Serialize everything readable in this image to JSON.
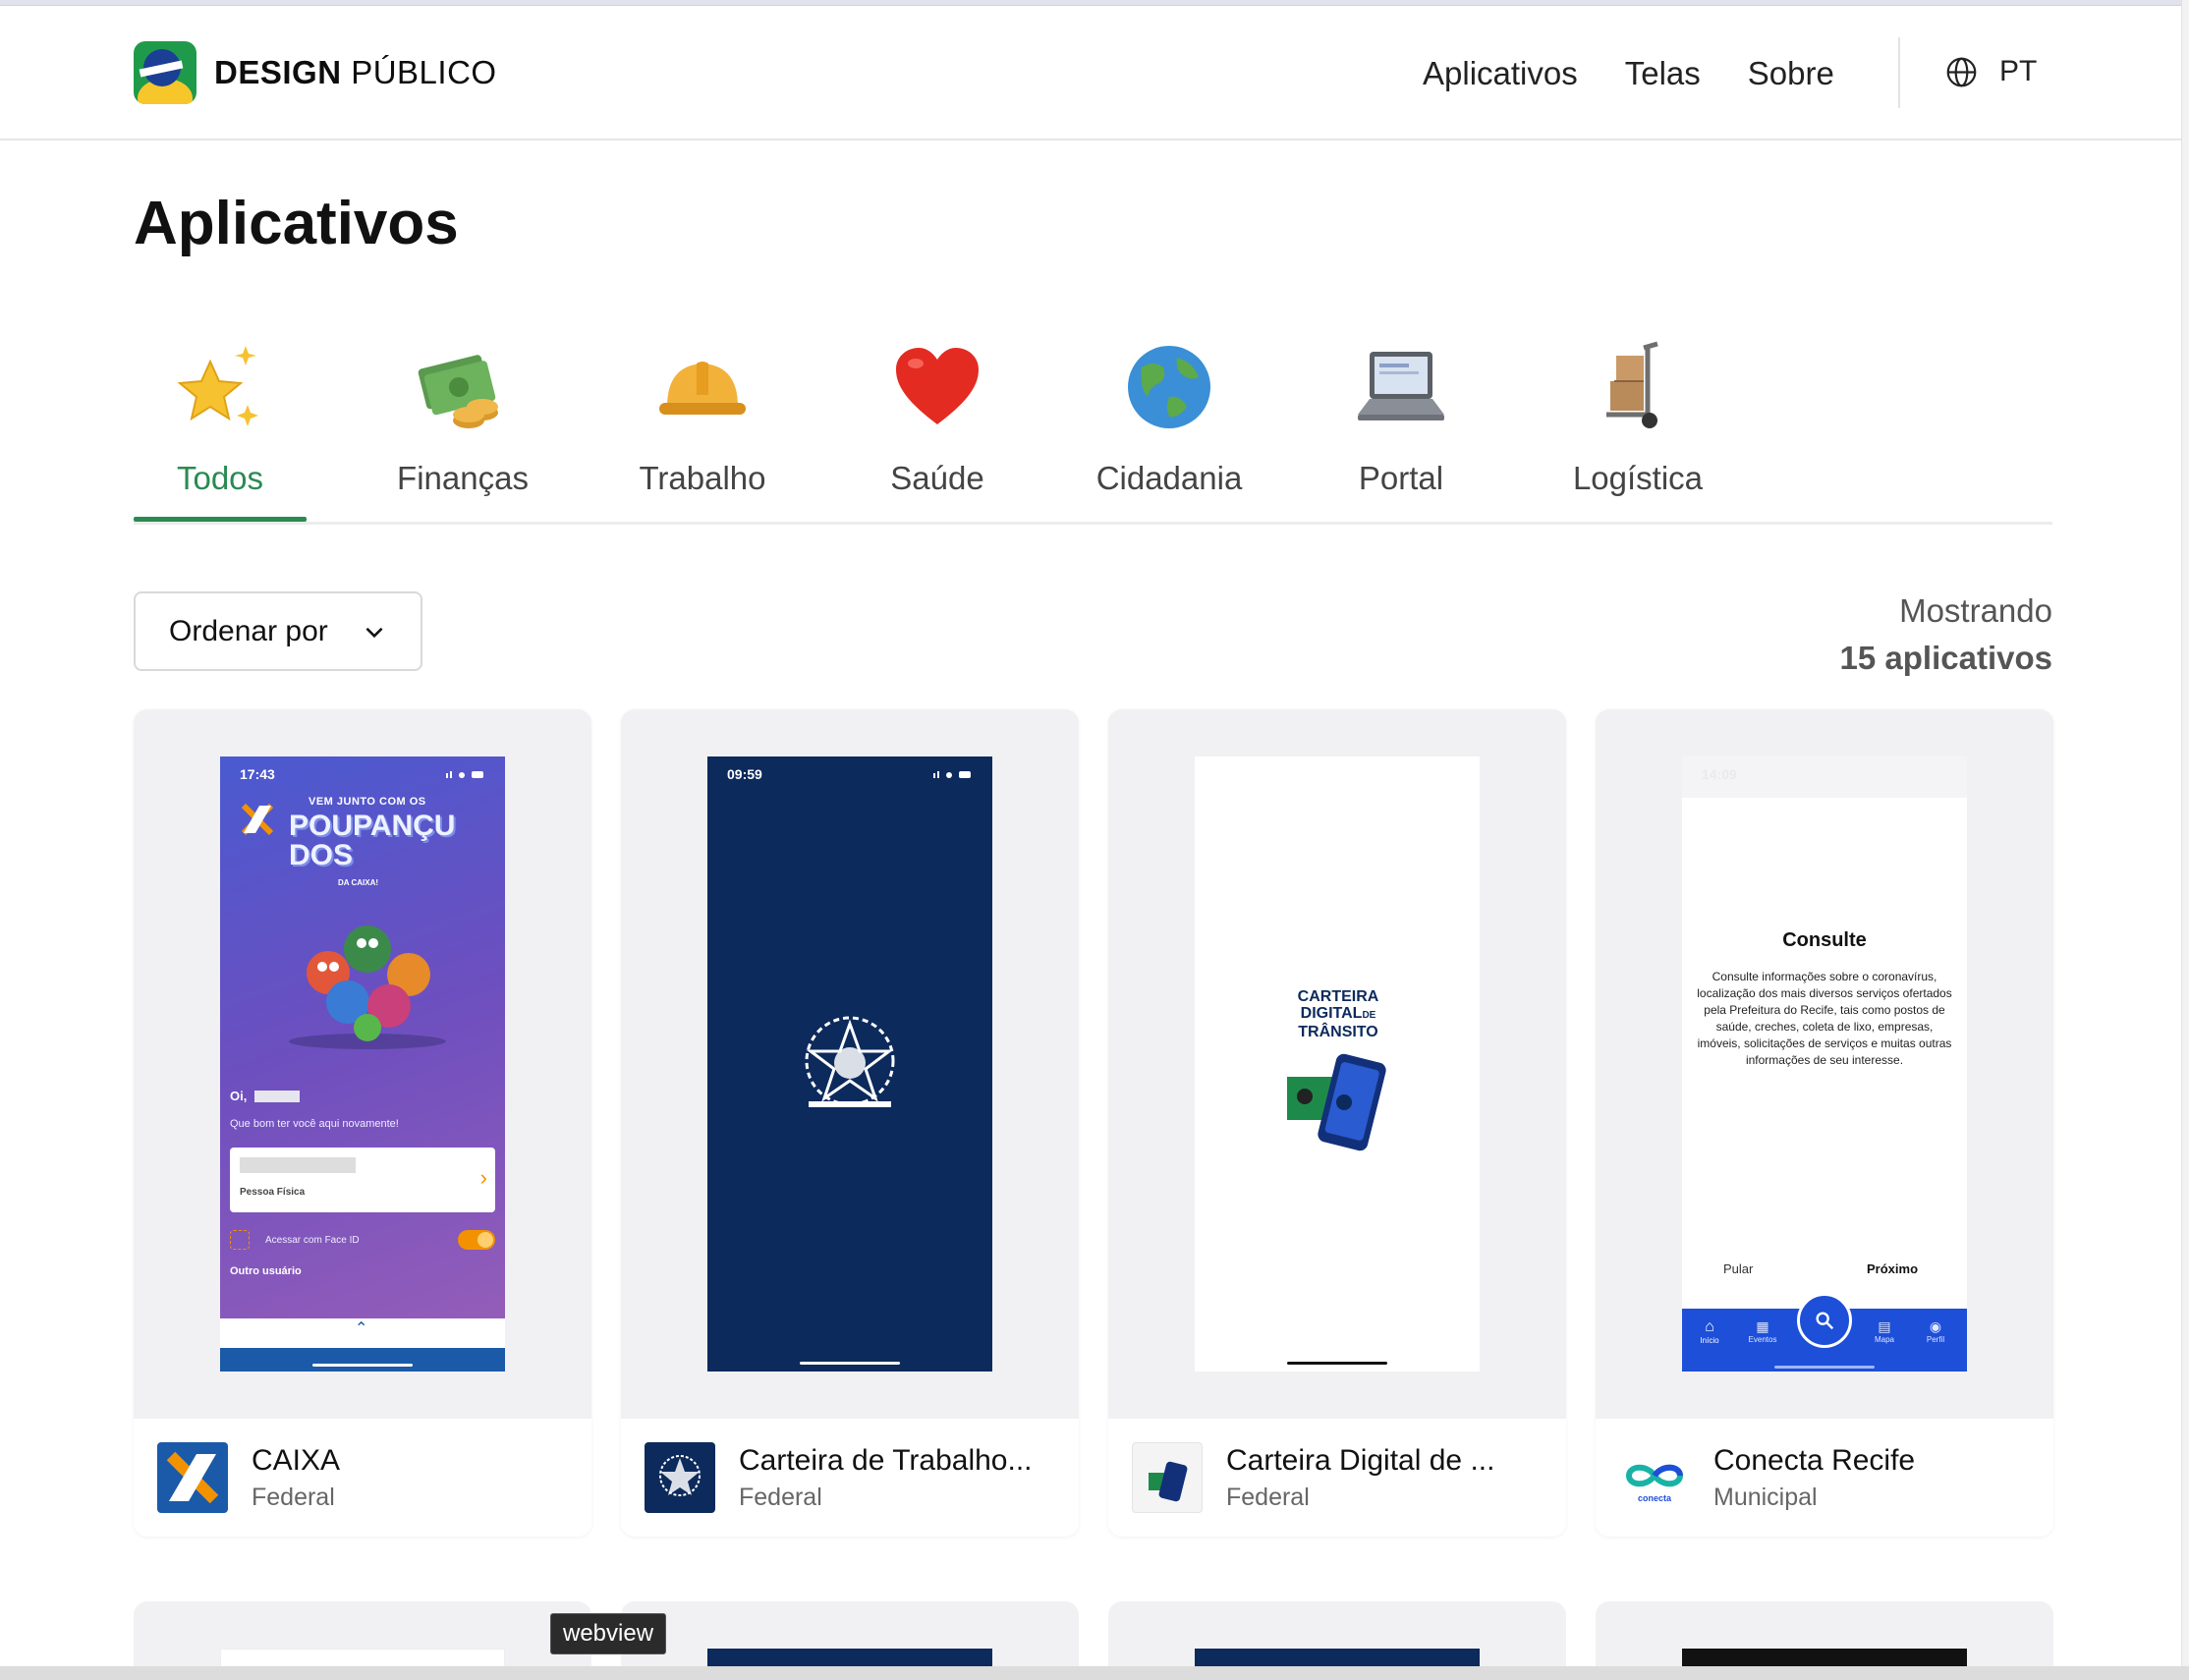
{
  "header": {
    "brand_bold": "DESIGN",
    "brand_regular": "PÚBLICO",
    "nav": [
      "Aplicativos",
      "Telas",
      "Sobre"
    ],
    "language": "PT"
  },
  "page": {
    "title": "Aplicativos"
  },
  "categories": [
    {
      "label": "Todos",
      "icon": "star-icon",
      "active": true
    },
    {
      "label": "Finanças",
      "icon": "money-icon"
    },
    {
      "label": "Trabalho",
      "icon": "hardhat-icon"
    },
    {
      "label": "Saúde",
      "icon": "heart-icon"
    },
    {
      "label": "Cidadania",
      "icon": "globe-icon"
    },
    {
      "label": "Portal",
      "icon": "laptop-icon"
    },
    {
      "label": "Logística",
      "icon": "handtruck-icon"
    }
  ],
  "sort": {
    "label": "Ordenar por"
  },
  "count": {
    "line1": "Mostrando",
    "line2": "15 aplicativos"
  },
  "apps": [
    {
      "name": "CAIXA",
      "level": "Federal",
      "screen": {
        "time": "17:43",
        "headline_top": "VEM JUNTO COM OS",
        "headline_main": "POUPANÇUDOS",
        "headline_bottom": "DA CAIXA!",
        "greeting": "Oi,",
        "welcome": "Que bom ter você aqui novamente!",
        "account_type": "Pessoa Física",
        "face_id": "Acessar com Face ID",
        "other_user": "Outro usuário"
      }
    },
    {
      "name": "Carteira de Trabalho...",
      "level": "Federal",
      "screen": {
        "time": "09:59"
      }
    },
    {
      "name": "Carteira Digital de ...",
      "level": "Federal",
      "screen": {
        "logo_line1": "CARTEIRA",
        "logo_line2": "DIGITAL",
        "logo_small": "DE",
        "logo_line3": "TRÂNSITO"
      }
    },
    {
      "name": "Conecta Recife",
      "level": "Municipal",
      "screen": {
        "time": "14:09",
        "title": "Consulte",
        "body": "Consulte informações sobre o coronavírus, localização dos mais diversos serviços ofertados pela Prefeitura do Recife, tais como postos de saúde, creches, coleta de lixo, empresas, imóveis, solicitações de serviços e muitas outras informações de seu interesse.",
        "skip": "Pular",
        "next": "Próximo",
        "tabs": [
          "Início",
          "Eventos",
          "Mapa",
          "Perfil"
        ],
        "brand_mark": "conecta"
      }
    }
  ],
  "tooltip": "webview",
  "colors": {
    "accent": "#2a8a52",
    "gov_navy": "#0c2a5c",
    "conecta_blue": "#1d4fd8",
    "caixa_blue": "#1a5aa8",
    "caixa_orange": "#f39200"
  }
}
